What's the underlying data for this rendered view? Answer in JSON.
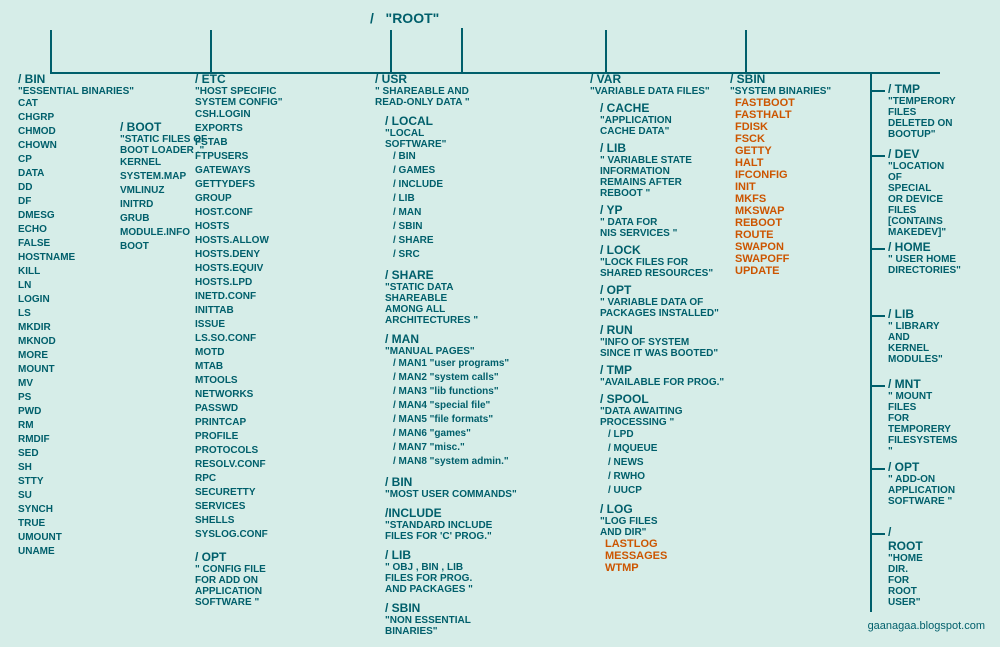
{
  "root": {
    "name": "/ ROOT",
    "desc": "\"HOME DIR. FOR ROOT USER\""
  },
  "bin": {
    "name": "/ BIN",
    "desc": "\"ESSENTIAL BINARIES\"",
    "files": [
      "CAT",
      "CHGRP",
      "CHMOD",
      "CHOWN",
      "CP",
      "DATA",
      "DD",
      "DF",
      "DMESG",
      "ECHO",
      "FALSE",
      "HOSTNAME",
      "KILL",
      "LN",
      "LOGIN",
      "LS",
      "MKDIR",
      "MKNOD",
      "MORE",
      "MOUNT",
      "MV",
      "PS",
      "PWD",
      "RM",
      "RMDIF",
      "SED",
      "SH",
      "STTY",
      "SU",
      "SYNCH",
      "TRUE",
      "UMOUNT",
      "UNAME"
    ]
  },
  "etc": {
    "name": "/ ETC",
    "desc": "\"HOST SPECIFIC SYSTEM CONFIG\"",
    "files": [
      "CSH.LOGIN",
      "EXPORTS",
      "FSTAB",
      "FTPUSERS",
      "GATEWAYS",
      "GETTYDEFS",
      "GROUP",
      "HOST.CONF",
      "HOSTS",
      "HOSTS.ALLOW",
      "HOSTS.DENY",
      "HOSTS.EQUIV",
      "HOSTS.LPD",
      "INETD.CONF",
      "INITTAB",
      "ISSUE",
      "LS.SO.CONF",
      "MOTD",
      "MTAB",
      "MTOOLS",
      "NETWORKS",
      "PASSWD",
      "PRINTCAP",
      "PROFILE",
      "PROTOCOLS",
      "RESOLV.CONF",
      "RPC",
      "SECURETTY",
      "SERVICES",
      "SHELLS",
      "SYSLOG.CONF"
    ],
    "opt": {
      "name": "/ OPT",
      "desc": "\" CONFIG FILE FOR ADD ON APPLICATION SOFTWARE \""
    }
  },
  "boot": {
    "name": "/ BOOT",
    "desc": "\"STATIC FILES OF BOOT LOADER .\"",
    "files": [
      "KERNEL",
      "SYSTEM.MAP",
      "VMLINUZ",
      "INITRD",
      "GRUB",
      "MODULE.INFO",
      "BOOT"
    ]
  },
  "usr": {
    "name": "/ USR",
    "desc": "\" SHAREABLE AND READ-ONLY DATA \"",
    "local": {
      "name": "/ LOCAL",
      "desc": "\"LOCAL SOFTWARE\"",
      "subdirs": [
        "/ BIN",
        "/ GAMES",
        "/ INCLUDE",
        "/ LIB",
        "/ MAN",
        "/ SBIN",
        "/ SHARE",
        "/ SRC"
      ]
    },
    "share": {
      "name": "/ SHARE",
      "desc": "\"STATIC DATA SHAREABLE AMONG ALL ARCHITECTURES \""
    },
    "man": {
      "name": "/ MAN",
      "desc": "\"MANUAL PAGES\"",
      "subdirs": [
        "/ MAN1 \"user programs\"",
        "/ MAN2 \"system calls\"",
        "/ MAN3 \"lib functions\"",
        "/ MAN4 \"special file\"",
        "/ MAN5 \"file formats\"",
        "/ MAN6 \"games\"",
        "/ MAN7 \"misc.\"",
        "/ MAN8 \"system admin.\""
      ]
    },
    "bin": {
      "name": "/ BIN",
      "desc": "\"MOST USER COMMANDS\""
    },
    "include": {
      "name": "/ INCLUDE",
      "desc": "\"STANDARD INCLUDE FILES FOR 'C' PROG.\""
    },
    "lib": {
      "name": "/ LIB",
      "desc": "\" OBJ , BIN , LIB FILES FOR PROG. AND PACKAGES \""
    },
    "sbin": {
      "name": "/ SBIN",
      "desc": "\"NON ESSENTIAL BINARIES\""
    }
  },
  "var": {
    "name": "/ VAR",
    "desc": "\"VARIABLE DATA FILES\"",
    "cache": {
      "name": "/ CACHE",
      "desc": "\"APPLICATION CACHE DATA\""
    },
    "lib": {
      "name": "/ LIB",
      "desc": "\" VARIABLE STATE INFORMATION REMAINS AFTER REBOOT \""
    },
    "yp": {
      "name": "/ YP",
      "desc": "\" DATA FOR NIS SERVICES \""
    },
    "lock": {
      "name": "/ LOCK",
      "desc": "\"LOCK FILES FOR SHARED RESOURCES\""
    },
    "opt": {
      "name": "/ OPT",
      "desc": "\" VARIABLE DATA OF PACKAGES INSTALLED\""
    },
    "run": {
      "name": "/ RUN",
      "desc": "\"INFO OF SYSTEM SINCE IT WAS BOOTED\""
    },
    "tmp": {
      "name": "/ TMP",
      "desc": "\"AVAILABLE FOR PROG.\""
    },
    "spool": {
      "name": "/ SPOOL",
      "desc": "\"DATA AWAITING PROCESSING \"",
      "subdirs": [
        "/ LPD",
        "/ MQUEUE",
        "/ NEWS",
        "/ RWHO",
        "/ UUCP"
      ]
    },
    "log": {
      "name": "/ LOG",
      "desc": "\"LOG FILES AND DIR\"",
      "files_orange": [
        "LASTLOG",
        "MESSAGES",
        "WTMP"
      ]
    }
  },
  "sbin": {
    "name": "/ SBIN",
    "desc": "\"SYSTEM BINARIES\"",
    "files_orange": [
      "FASTBOOT",
      "FASTHALT",
      "FDISK",
      "FSCK",
      "GETTY",
      "HALT",
      "IFCONFIG",
      "INIT",
      "MKFS",
      "MKSWAP",
      "REBOOT",
      "ROUTE",
      "SWAPON",
      "SWAPOFF",
      "UPDATE"
    ]
  },
  "tmp": {
    "name": "/ TMP",
    "desc": "\"TEMPERORY FILES DELETED ON BOOTUP\""
  },
  "dev": {
    "name": "/ DEV",
    "desc": "\"LOCATION OF SPECIAL OR DEVICE FILES [CONTAINS MAKEDEV]\""
  },
  "home": {
    "name": "/ HOME",
    "desc": "\" USER HOME DIRECTORIES\""
  },
  "lib": {
    "name": "/ LIB",
    "desc": "\"  LIBRARY AND KERNEL MODULES\""
  },
  "mnt": {
    "name": "/ MNT",
    "desc": "\"  MOUNT FILES FOR TEMPORERY FILESYSTEMS \""
  },
  "opt": {
    "name": "/ OPT",
    "desc": "\" ADD-ON APPLICATION SOFTWARE \""
  },
  "watermark": "gaanagaa.blogspot.com"
}
